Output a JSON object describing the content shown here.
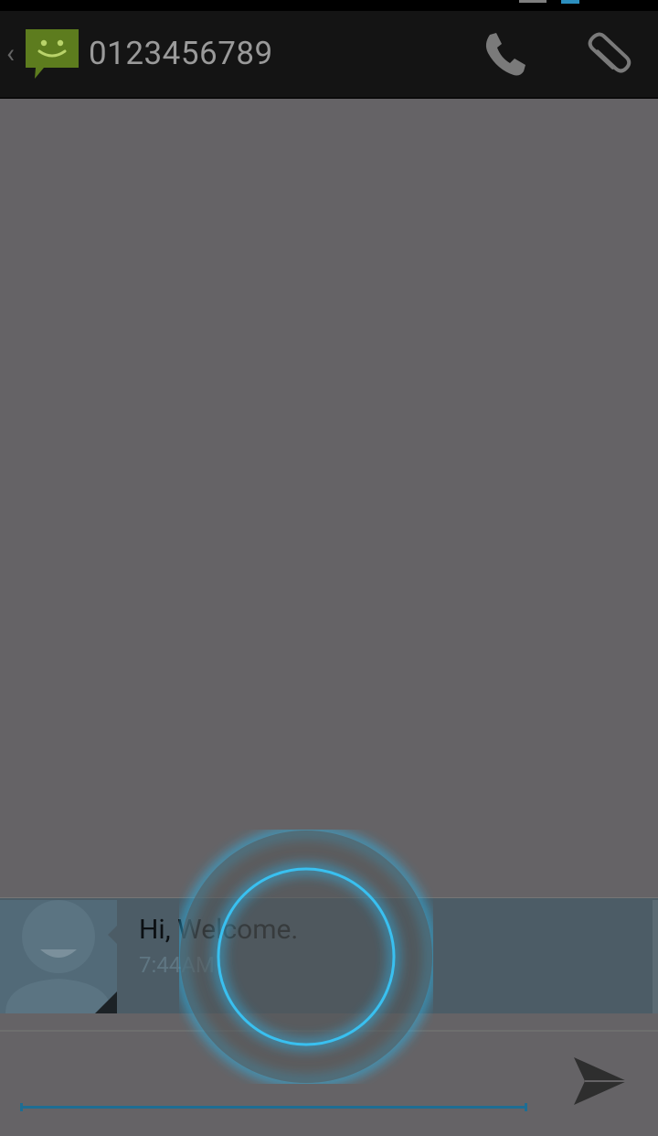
{
  "conversation": {
    "title": "0123456789"
  },
  "icons": {
    "up": "chevron-left-icon",
    "app": "messaging-smiley-icon",
    "call": "phone-icon",
    "attach": "paperclip-icon",
    "avatar": "contact-avatar-placeholder",
    "send": "send-icon"
  },
  "messages": [
    {
      "text": "Hi, Welcome.",
      "time": "7:44AM",
      "direction": "incoming"
    }
  ],
  "compose": {
    "placeholder": "",
    "value": ""
  },
  "colors": {
    "accent": "#33b5e5",
    "app_icon": "#5d7c1e",
    "actionbar": "#141414",
    "background": "#656366",
    "message_row": "#4c5c66"
  }
}
